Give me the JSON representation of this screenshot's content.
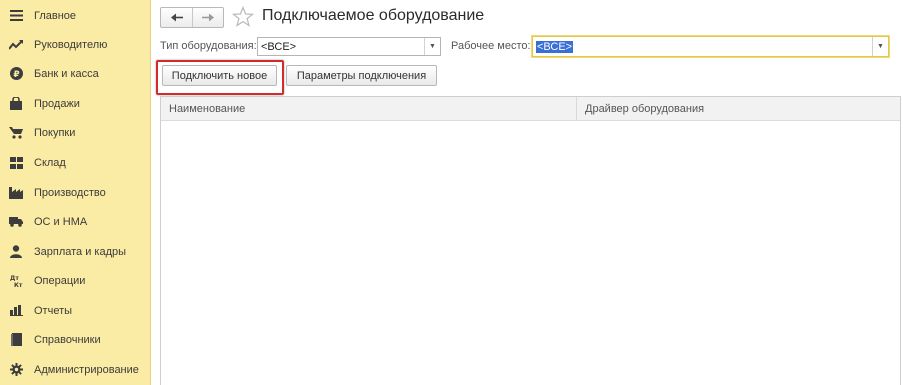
{
  "sidebar": {
    "items": [
      {
        "label": "Главное",
        "icon": "menu-icon"
      },
      {
        "label": "Руководителю",
        "icon": "trend-icon"
      },
      {
        "label": "Банк и касса",
        "icon": "coin-icon"
      },
      {
        "label": "Продажи",
        "icon": "bag-icon"
      },
      {
        "label": "Покупки",
        "icon": "cart-icon"
      },
      {
        "label": "Склад",
        "icon": "warehouse-icon"
      },
      {
        "label": "Производство",
        "icon": "factory-icon"
      },
      {
        "label": "ОС и НМА",
        "icon": "truck-icon"
      },
      {
        "label": "Зарплата и кадры",
        "icon": "person-icon"
      },
      {
        "label": "Операции",
        "icon": "debit-credit-icon"
      },
      {
        "label": "Отчеты",
        "icon": "bar-chart-icon"
      },
      {
        "label": "Справочники",
        "icon": "book-icon"
      },
      {
        "label": "Администрирование",
        "icon": "gear-icon"
      }
    ]
  },
  "header": {
    "title": "Подключаемое оборудование"
  },
  "filters": {
    "equipment_type_label": "Тип оборудования:",
    "equipment_type_value": "<ВСЕ>",
    "workplace_label": "Рабочее место:",
    "workplace_value": "<ВСЕ>"
  },
  "toolbar": {
    "connect_new_label": "Подключить новое",
    "connection_params_label": "Параметры подключения"
  },
  "table": {
    "columns": [
      "Наименование",
      "Драйвер оборудования"
    ],
    "rows": []
  },
  "colors": {
    "sidebar_bg": "#fbeca5",
    "highlight": "#3a6fd8",
    "focus_border": "#e6c64a",
    "callout_frame": "#d32a2a"
  }
}
